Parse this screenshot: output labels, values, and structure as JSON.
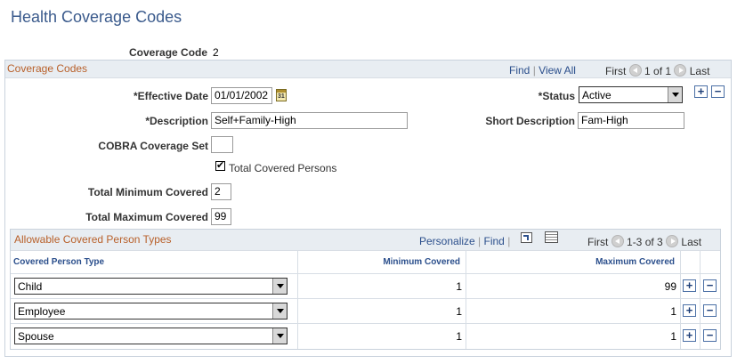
{
  "page": {
    "title": "Health Coverage Codes"
  },
  "coverage_code": {
    "label": "Coverage Code",
    "value": "2"
  },
  "coverage_group": {
    "title": "Coverage Codes",
    "nav": {
      "find": "Find",
      "sep1": "|",
      "view_all": "View All",
      "first": "First",
      "range": "1 of 1",
      "last": "Last"
    }
  },
  "fields": {
    "effective_date": {
      "label": "*Effective Date",
      "value": "01/01/2002"
    },
    "status": {
      "label": "*Status",
      "value": "Active"
    },
    "description": {
      "label": "*Description",
      "value": "Self+Family-High"
    },
    "short_description": {
      "label": "Short Description",
      "value": "Fam-High"
    },
    "cobra_coverage_set": {
      "label": "COBRA Coverage Set",
      "value": ""
    },
    "total_covered_persons": {
      "label": "Total Covered Persons",
      "checked": true,
      "mark": "✔"
    },
    "total_minimum_covered": {
      "label": "Total Minimum Covered",
      "value": "2"
    },
    "total_maximum_covered": {
      "label": "Total Maximum Covered",
      "value": "99"
    }
  },
  "buttons": {
    "add": "+",
    "remove": "−"
  },
  "grid": {
    "title": "Allowable Covered Person Types",
    "nav": {
      "personalize": "Personalize",
      "sep1": "|",
      "find": "Find",
      "sep2": "|",
      "first": "First",
      "range": "1-3 of 3",
      "last": "Last"
    },
    "columns": [
      "Covered Person Type",
      "Minimum Covered",
      "Maximum Covered"
    ],
    "rows": [
      {
        "type": "Child",
        "min": "1",
        "max": "99"
      },
      {
        "type": "Employee",
        "min": "1",
        "max": "1"
      },
      {
        "type": "Spouse",
        "min": "1",
        "max": "1"
      }
    ]
  },
  "colors": {
    "title": "#3a5a8c",
    "group_title": "#b8602a",
    "header_bg": "#e8edf2",
    "link": "#2b4f8c"
  }
}
